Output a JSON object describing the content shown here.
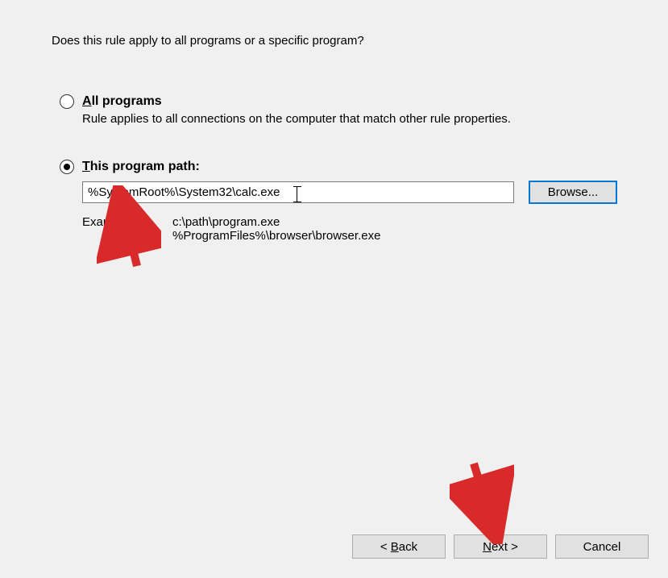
{
  "question": "Does this rule apply to all programs or a specific program?",
  "options": {
    "all": {
      "label_first": "A",
      "label_rest": "ll programs",
      "description": "Rule applies to all connections on the computer that match other rule properties."
    },
    "path": {
      "label_first": "T",
      "label_rest": "his program path:",
      "input_value": "%SystemRoot%\\System32\\calc.exe",
      "browse_label": "Browse...",
      "example_label": "Example:",
      "example_line1": "c:\\path\\program.exe",
      "example_line2": "%ProgramFiles%\\browser\\browser.exe"
    }
  },
  "footer": {
    "back_prefix": "< ",
    "back_u": "B",
    "back_suffix": "ack",
    "next_u": "N",
    "next_suffix": "ext >",
    "cancel": "Cancel"
  }
}
